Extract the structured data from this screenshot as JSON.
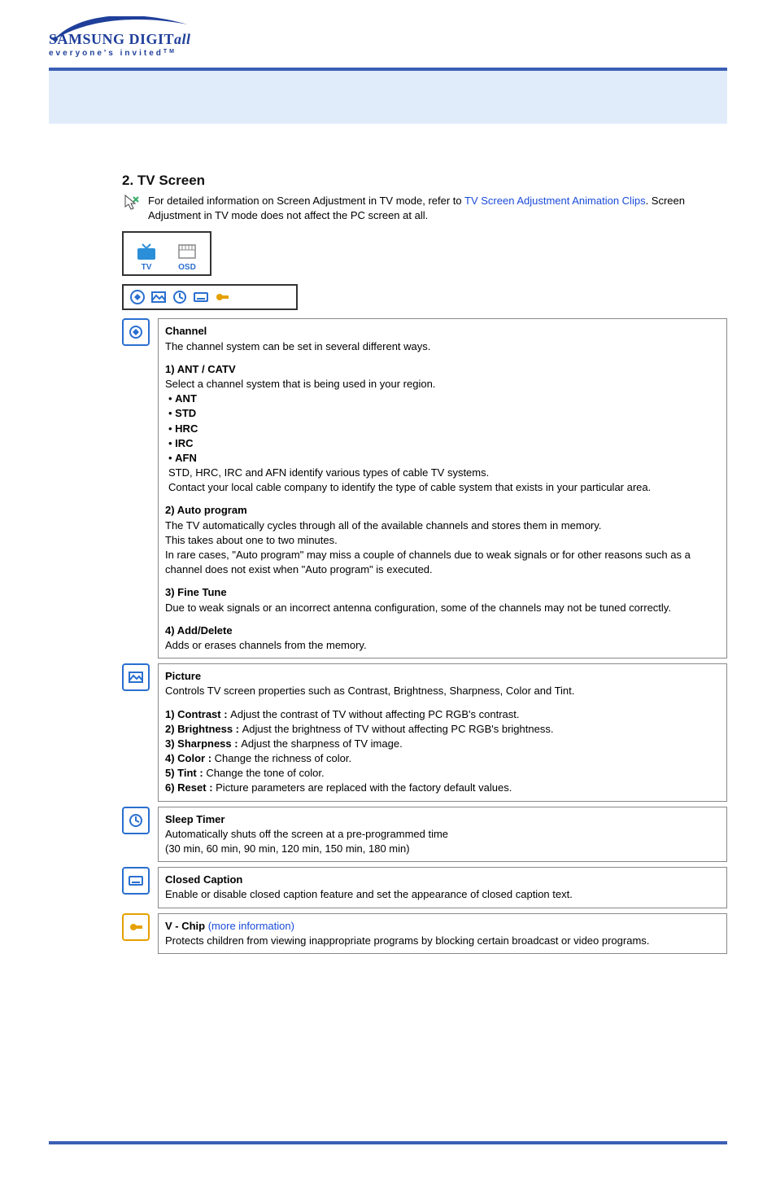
{
  "logo": {
    "brand_line1_a": "SAMSUNG DIGIT",
    "brand_line1_b": "all",
    "tagline_prefix": "everyone's invited",
    "tagline_tm": "TM"
  },
  "section": {
    "title": "2. TV Screen",
    "intro_pre": "For detailed information on Screen Adjustment in TV mode, refer to ",
    "intro_link": "TV Screen Adjustment Animation Clips",
    "intro_post": ". Screen Adjustment in TV mode does not affect the PC screen at all."
  },
  "tvosd": {
    "tv_label": "TV",
    "osd_label": "OSD"
  },
  "rows": {
    "channel": {
      "title": "Channel",
      "sub": "The channel system can be set in several different ways.",
      "s1_head": "1) ANT / CATV",
      "s1_desc": "Select a channel system that is being used in your region.",
      "opts": [
        "ANT",
        "STD",
        "HRC",
        "IRC",
        "AFN"
      ],
      "s1_note_a": "STD, HRC, IRC and AFN identify various types of cable TV systems.",
      "s1_note_b": "Contact your local cable company to identify the type of cable system that exists in your particular area.",
      "s2_head": "2) Auto program",
      "s2_a": "The TV automatically cycles through all of the available channels and stores them in memory.",
      "s2_b": "This takes about one to two minutes.",
      "s2_c": "In rare cases, \"Auto program\" may miss a couple of channels due to weak signals or for other reasons such as a channel does not exist when \"Auto program\" is executed.",
      "s3_head": "3) Fine Tune",
      "s3_a": "Due to weak signals or an incorrect antenna configuration, some of the channels may not be tuned correctly.",
      "s4_head": "4) Add/Delete",
      "s4_a": "Adds or erases channels from the memory."
    },
    "picture": {
      "title": "Picture",
      "sub": "Controls TV screen properties such as Contrast, Brightness, Sharpness, Color and Tint.",
      "items": [
        {
          "b": "1) Contrast : ",
          "t": "Adjust the contrast of TV without affecting PC RGB's contrast."
        },
        {
          "b": "2) Brightness : ",
          "t": "Adjust the brightness of TV without affecting PC RGB's brightness."
        },
        {
          "b": "3) Sharpness : ",
          "t": "Adjust the sharpness of TV image."
        },
        {
          "b": "4) Color : ",
          "t": "Change the richness of color."
        },
        {
          "b": "5) Tint : ",
          "t": "Change the tone of color."
        },
        {
          "b": "6) Reset : ",
          "t": "Picture parameters are replaced with the factory default values."
        }
      ]
    },
    "sleep": {
      "title": "Sleep Timer",
      "sub_a": "Automatically shuts off the screen at a pre-programmed time",
      "sub_b": "(30 min, 60 min, 90 min, 120 min, 150 min, 180 min)"
    },
    "cc": {
      "title": "Closed Caption",
      "sub": "Enable or disable closed caption feature and set the appearance of closed caption text."
    },
    "vchip": {
      "title": "V - Chip",
      "more": " (more information)",
      "sub": "Protects children from viewing inappropriate programs by blocking certain broadcast or video programs."
    }
  }
}
